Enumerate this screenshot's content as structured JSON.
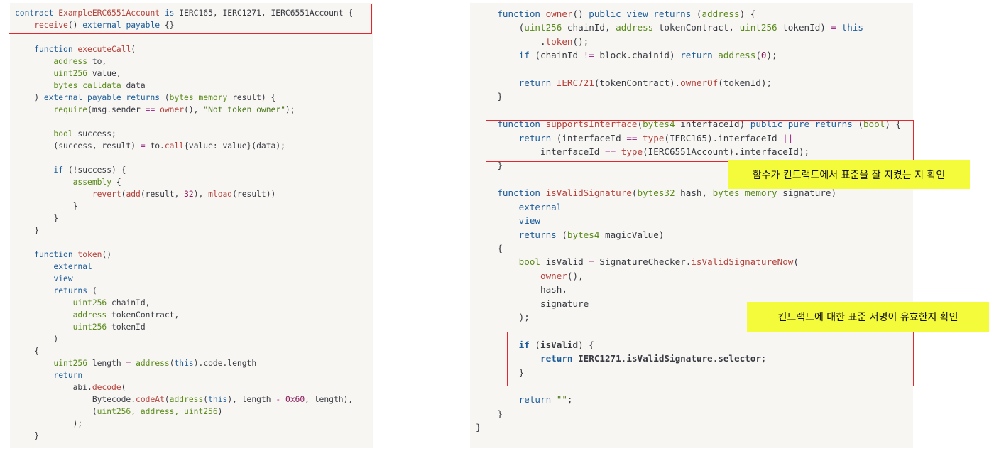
{
  "left_code": {
    "l1a": "contract",
    "l1b": " ExampleERC6551Account",
    "l1c": " is",
    "l1d": " IERC165, IERC1271, IERC6551Account {",
    "l2a": "    receive",
    "l2b": "()",
    "l2c": " external payable",
    "l2d": " {}",
    "l4a": "    function",
    "l4b": " executeCall",
    "l4c": "(",
    "l5a": "        address",
    "l5b": " to,",
    "l6a": "        uint256",
    "l6b": " value,",
    "l7a": "        bytes",
    "l7b": " calldata",
    "l7c": " data",
    "l8a": "    ) ",
    "l8b": "external payable returns",
    "l8c": " (",
    "l8d": "bytes memory",
    "l8e": " result) {",
    "l9a": "        require",
    "l9b": "(msg.sender ",
    "l9c": "==",
    "l9d": " owner",
    "l9e": "(), ",
    "l9f": "\"Not token owner\"",
    "l9g": ");",
    "l11a": "        bool",
    "l11b": " success;",
    "l12a": "        (success, result) ",
    "l12b": "=",
    "l12c": " to.",
    "l12d": "call",
    "l12e": "{value: value}(data);",
    "l14a": "        if",
    "l14b": " (!success) {",
    "l15a": "            assembly",
    "l15b": " {",
    "l16a": "                revert",
    "l16b": "(",
    "l16c": "add",
    "l16d": "(result, ",
    "l16e": "32",
    "l16f": "), ",
    "l16g": "mload",
    "l16h": "(result))",
    "l17": "            }",
    "l18": "        }",
    "l19": "    }",
    "l21a": "    function",
    "l21b": " token",
    "l21c": "()",
    "l22": "        external",
    "l23": "        view",
    "l24a": "        returns",
    "l24b": " (",
    "l25a": "            uint256",
    "l25b": " chainId,",
    "l26a": "            address",
    "l26b": " tokenContract,",
    "l27a": "            uint256",
    "l27b": " tokenId",
    "l28": "        )",
    "l29": "    {",
    "l30a": "        uint256",
    "l30b": " length ",
    "l30c": "=",
    "l30d": " address",
    "l30e": "(",
    "l30f": "this",
    "l30g": ").code.length",
    "l31": "        return",
    "l32a": "            abi.",
    "l32b": "decode",
    "l32c": "(",
    "l33a": "                Bytecode.",
    "l33b": "codeAt",
    "l33c": "(",
    "l33d": "address",
    "l33e": "(",
    "l33f": "this",
    "l33g": "), length ",
    "l33h": "-",
    "l33i": " 0x60",
    "l33j": ", length),",
    "l34a": "                (",
    "l34b": "uint256, address, uint256",
    "l34c": ")",
    "l35": "            );",
    "l36": "    }"
  },
  "right_code": {
    "r1a": "    function",
    "r1b": " owner",
    "r1c": "()",
    "r1d": " public view returns",
    "r1e": " (",
    "r1f": "address",
    "r1g": ") {",
    "r2a": "        (",
    "r2b": "uint256",
    "r2c": " chainId, ",
    "r2d": "address",
    "r2e": " tokenContract, ",
    "r2f": "uint256",
    "r2g": " tokenId) ",
    "r2h": "=",
    "r2i": " this",
    "r3a": "            .",
    "r3b": "token",
    "r3c": "();",
    "r4a": "        if",
    "r4b": " (chainId ",
    "r4c": "!=",
    "r4d": " block.chainid) ",
    "r4e": "return",
    "r4f": " address",
    "r4g": "(",
    "r4h": "0",
    "r4i": ");",
    "r6a": "        return",
    "r6b": " IERC721",
    "r6c": "(tokenContract).",
    "r6d": "ownerOf",
    "r6e": "(tokenId);",
    "r7": "    }",
    "r9a": "    function",
    "r9b": " supportsInterface",
    "r9c": "(",
    "r9d": "bytes4",
    "r9e": " interfaceId) ",
    "r9f": "public pure returns",
    "r9g": " (",
    "r9h": "bool",
    "r9i": ") {",
    "r10a": "        return",
    "r10b": " (interfaceId ",
    "r10c": "==",
    "r10d": " type",
    "r10e": "(IERC165).interfaceId ",
    "r10f": "||",
    "r11a": "            interfaceId ",
    "r11b": "==",
    "r11c": " type",
    "r11d": "(IERC6551Account).interfaceId);",
    "r12": "    }",
    "r14a": "    function",
    "r14b": " isValidSignature",
    "r14c": "(",
    "r14d": "bytes32",
    "r14e": " hash, ",
    "r14f": "bytes memory",
    "r14g": " signature)",
    "r15": "        external",
    "r16": "        view",
    "r17a": "        returns",
    "r17b": " (",
    "r17c": "bytes4",
    "r17d": " magicValue)",
    "r18": "    {",
    "r19a": "        bool",
    "r19b": " isValid ",
    "r19c": "=",
    "r19d": " SignatureChecker.",
    "r19e": "isValidSignatureNow",
    "r19f": "(",
    "r20a": "            owner",
    "r20b": "(),",
    "r21": "            hash,",
    "r22": "            signature",
    "r23": "        );",
    "r25a": "        if",
    "r25b": " (",
    "r25c": "isValid",
    "r25d": ") {",
    "r26a": "            return",
    "r26b": " IERC1271",
    "r26c": ".",
    "r26d": "isValidSignature",
    "r26e": ".",
    "r26f": "selector",
    "r26g": ";",
    "r27": "        }",
    "r29a": "        return",
    "r29b": " \"\"",
    "r29c": ";",
    "r30": "    }",
    "r31": "}"
  },
  "annotations": {
    "note1": "함수가 컨트랙트에서 표준을 잘 지켰는 지 확인",
    "note2": "컨트랙트에 대한 표준 서명이 유효한지 확인"
  },
  "colors": {
    "keyword": "#1d5d9b",
    "type": "#5a8a1a",
    "function": "#b5413a",
    "string": "#4e7a1f",
    "number": "#8a1a5a",
    "highlight_border": "#e0282e",
    "note_bg": "#f4fb3a",
    "panel_bg": "#f7f6f3"
  }
}
